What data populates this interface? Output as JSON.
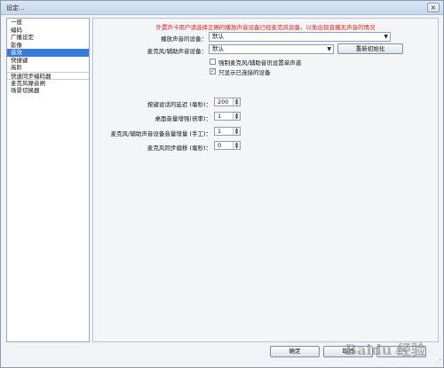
{
  "window": {
    "title": "设定...",
    "close_glyph": "×"
  },
  "sidebar": {
    "items": [
      {
        "label": "一般",
        "selected": false
      },
      {
        "label": "编码",
        "selected": false
      },
      {
        "label": "广播设定",
        "selected": false
      },
      {
        "label": "影像",
        "selected": false
      },
      {
        "label": "音效",
        "selected": true
      },
      {
        "label": "快捷键",
        "selected": false
      },
      {
        "label": "高阶",
        "selected": false
      },
      {
        "label": "快速同步编码器",
        "selected": false
      },
      {
        "label": "麦克风噪音闸",
        "selected": false
      },
      {
        "label": "场景切换器",
        "selected": false
      }
    ]
  },
  "panel": {
    "warning": "外置声卡用户请选择正确的播放声音设备已经麦克风设备，以免出现直播无声音的情况",
    "playback_label": "播放声音的设备：",
    "playback_value": "默认",
    "mic_label": "麦克风/辅助声音设备：",
    "mic_value": "默认",
    "reinit_button": "重新初始化",
    "force_mono_label": "强制麦克风/辅助音讯设置单声道",
    "force_mono_checked": false,
    "show_connected_label": "只显示已连接的设备",
    "show_connected_checked": true,
    "ptt_delay_label": "按键说话的延迟 (毫秒)：",
    "ptt_delay_value": "200",
    "desktop_boost_label": "桌面音量增强(倍率)：",
    "desktop_boost_value": "1",
    "mic_boost_label": "麦克风/辅助声音设备音量增量 (手工)：",
    "mic_boost_value": "1",
    "mic_sync_label": "麦克风同步偏移 (毫秒)：",
    "mic_sync_value": "0"
  },
  "footer": {
    "ok": "确定",
    "cancel": "取消",
    "apply": "应用"
  },
  "watermark": "Baidu 经验",
  "colors": {
    "selected": "#3a7bd5",
    "warning": "#e02020"
  }
}
